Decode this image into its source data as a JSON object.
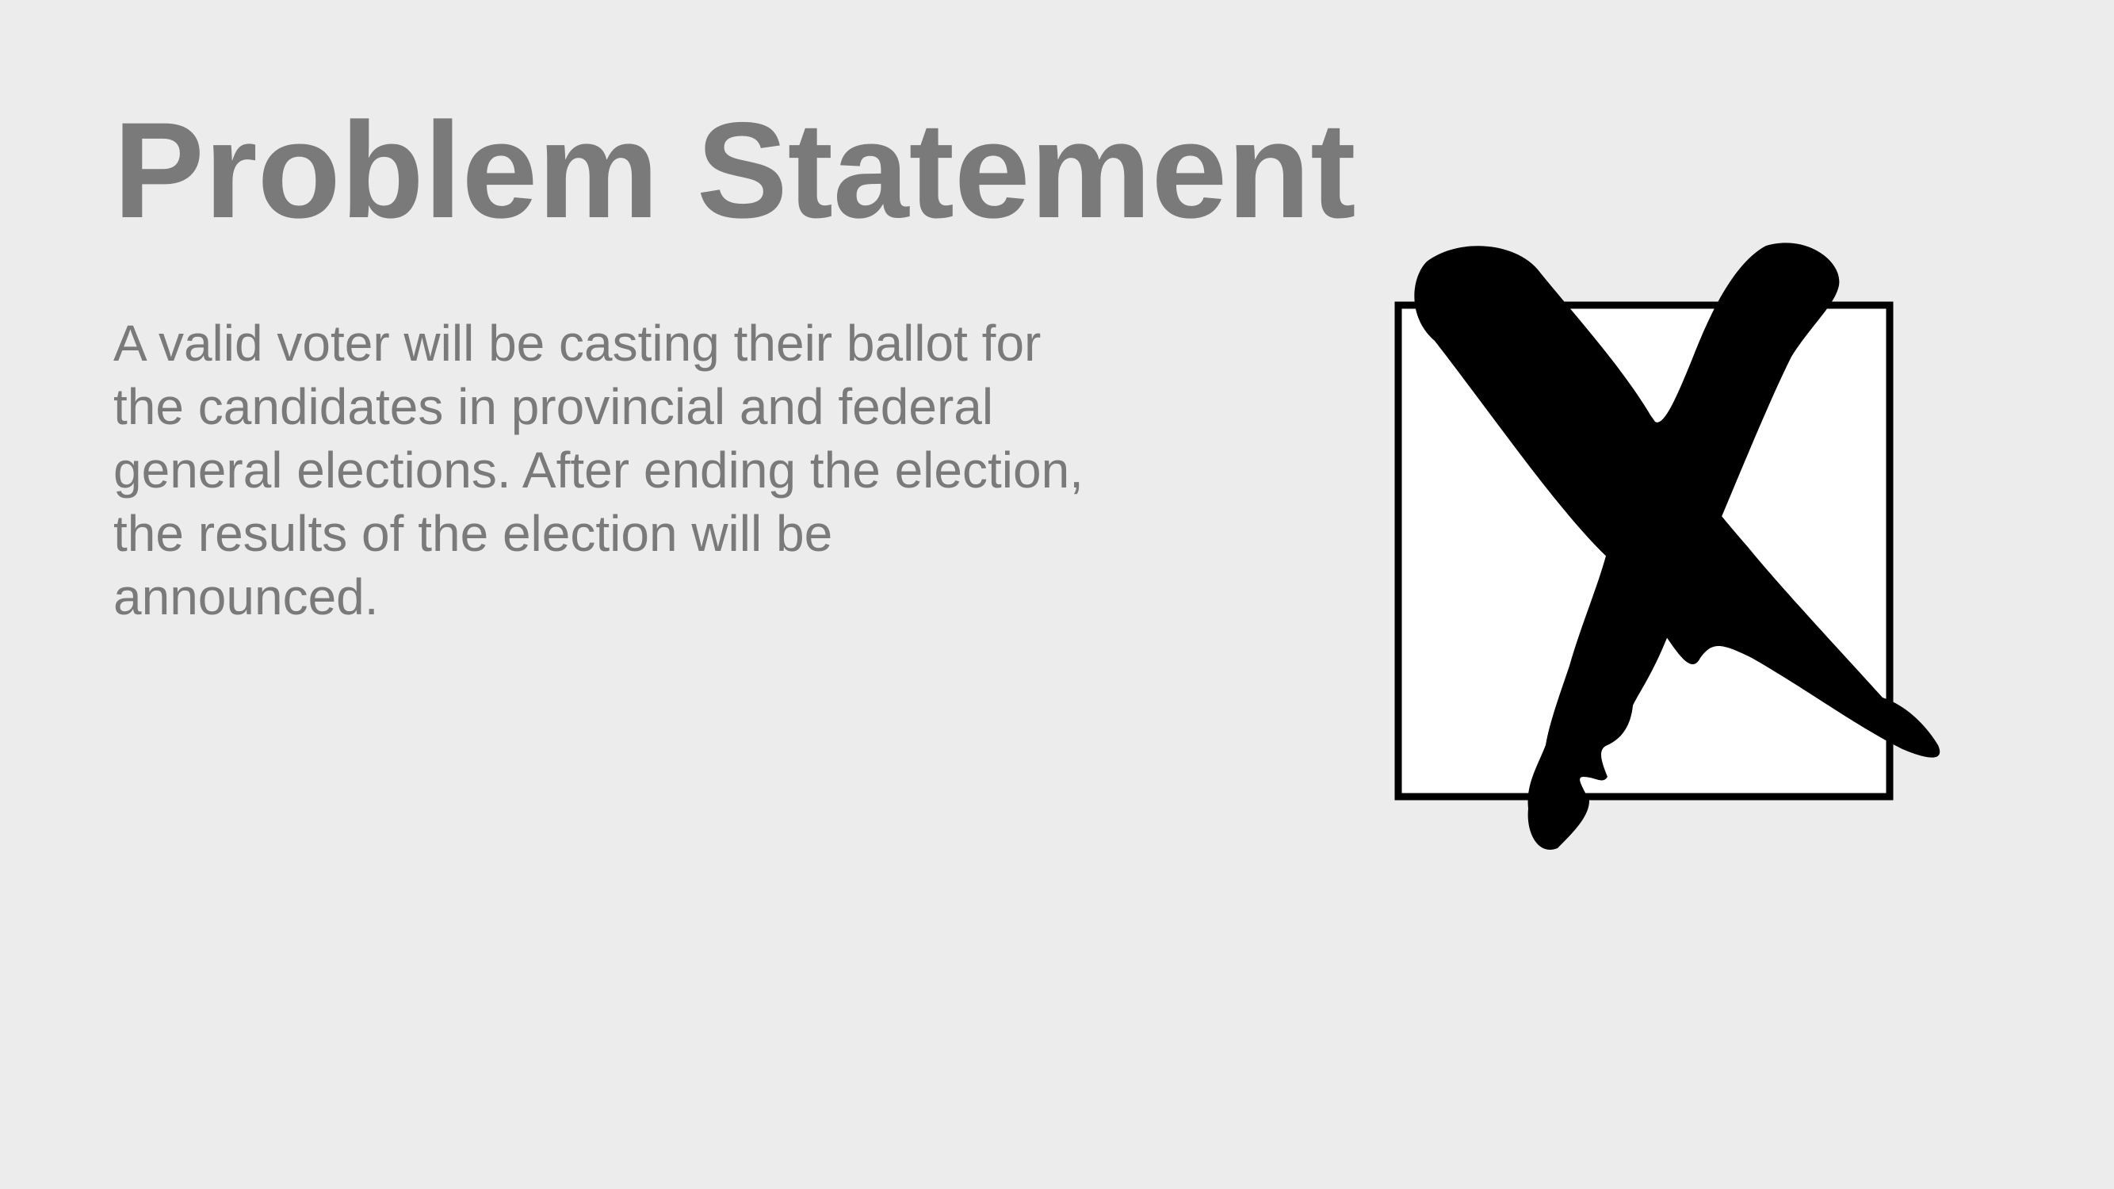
{
  "slide": {
    "title": "Problem Statement",
    "body": "A valid voter will be casting their ballot for the candidates in provincial and federal general elections. After ending the election, the results of the election will be announced.",
    "image": {
      "icon": "ballot-x-mark-icon"
    }
  },
  "colors": {
    "background": "#ececec",
    "text": "#7a7a7a",
    "box_fill": "#ffffff",
    "mark": "#000000"
  }
}
